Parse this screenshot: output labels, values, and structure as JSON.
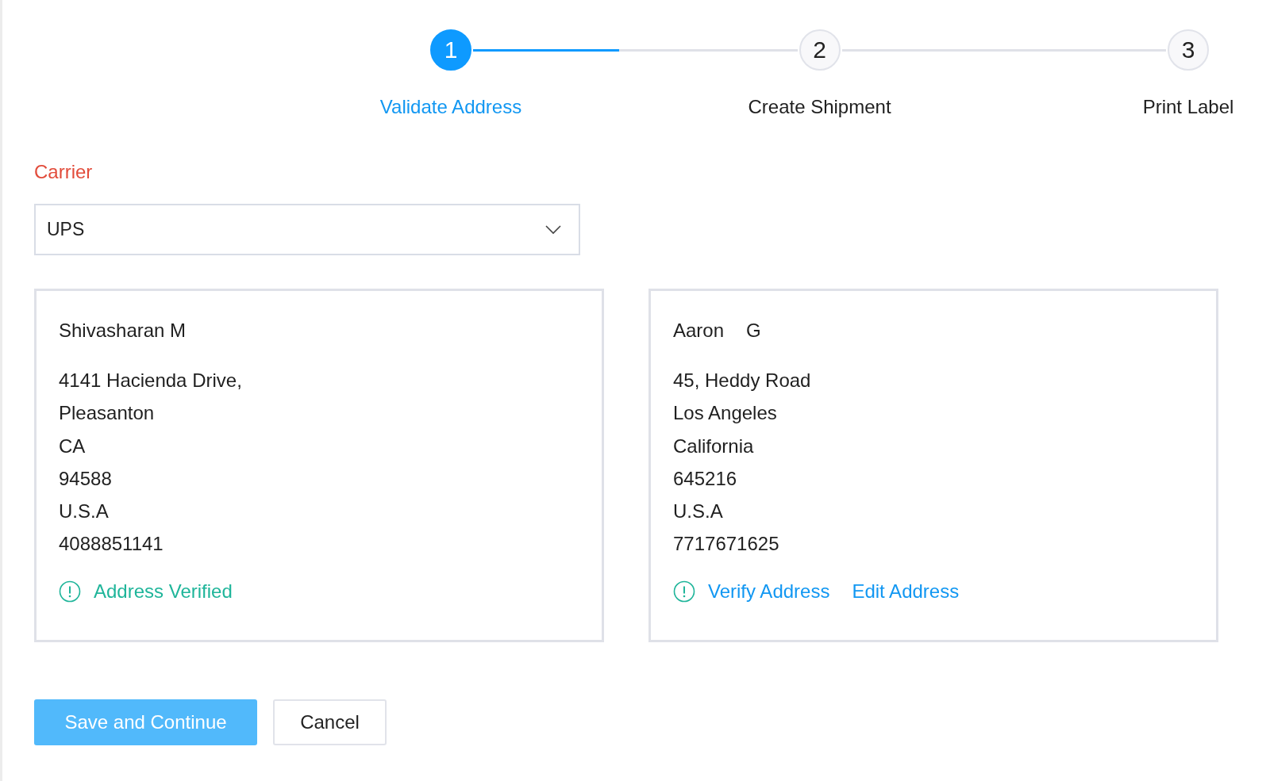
{
  "steps": [
    {
      "number": "1",
      "label": "Validate Address",
      "selected": true
    },
    {
      "number": "2",
      "label": "Create Shipment",
      "selected": false
    },
    {
      "number": "3",
      "label": "Print Label",
      "selected": false
    }
  ],
  "carrier": {
    "label": "Carrier",
    "value": "UPS"
  },
  "addresses": [
    {
      "first_name": "Shivasharan M",
      "lines": [
        "4141 Hacienda Drive,",
        "Pleasanton",
        "CA",
        "94588",
        "U.S.A",
        "4088851141"
      ],
      "status": "Address Verified"
    },
    {
      "first_name": "Aaron",
      "last_name": "G",
      "lines": [
        "45, Heddy Road",
        "Los Angeles",
        "California",
        "645216",
        "U.S.A",
        "7717671625"
      ],
      "actions": [
        "Verify Address",
        "Edit Address"
      ]
    }
  ],
  "buttons": {
    "primary": "Save and Continue",
    "secondary": "Cancel"
  }
}
